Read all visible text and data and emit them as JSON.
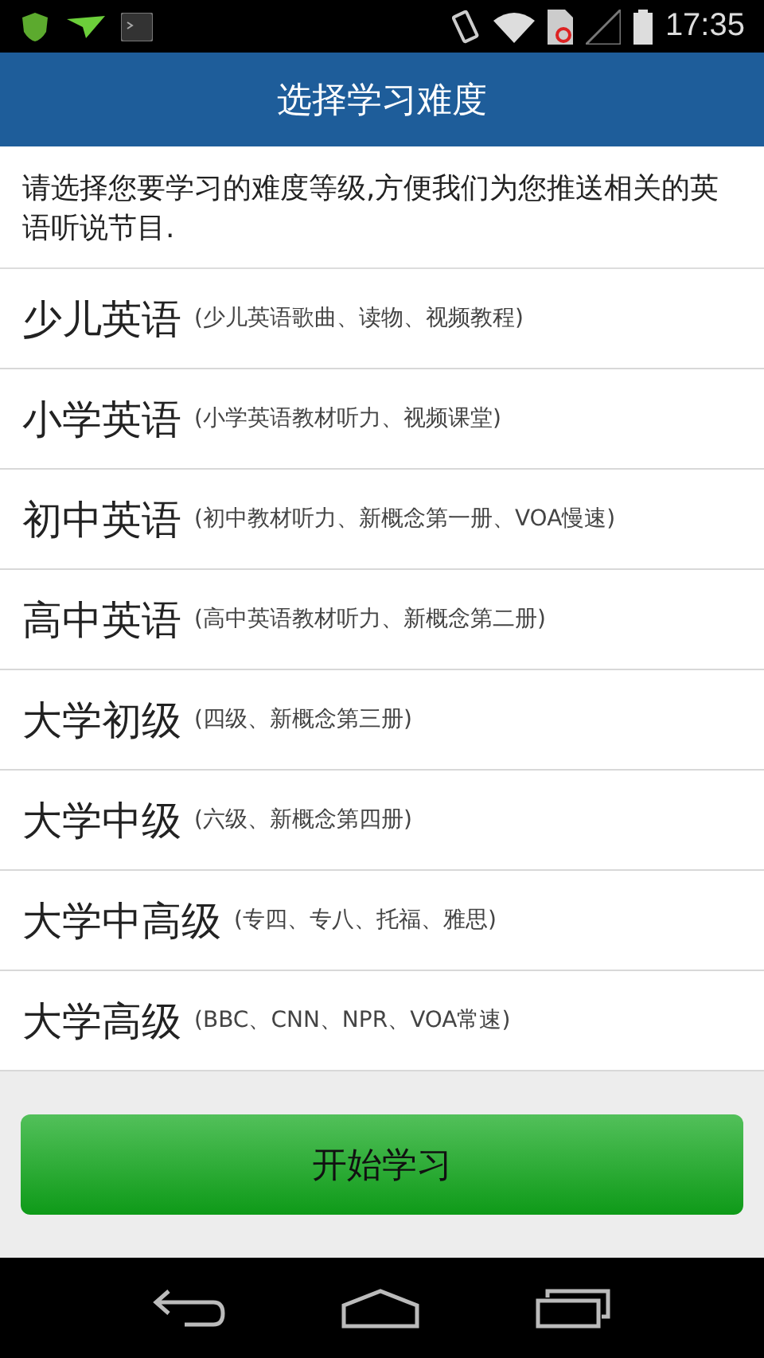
{
  "status_bar": {
    "time": "17:35"
  },
  "title": "选择学习难度",
  "intro": "请选择您要学习的难度等级,方便我们为您推送相关的英语听说节目.",
  "levels": [
    {
      "name": "少儿英语",
      "detail": "(少儿英语歌曲、读物、视频教程)"
    },
    {
      "name": "小学英语",
      "detail": "(小学英语教材听力、视频课堂)"
    },
    {
      "name": "初中英语",
      "detail": "(初中教材听力、新概念第一册、VOA慢速)"
    },
    {
      "name": "高中英语",
      "detail": "(高中英语教材听力、新概念第二册)"
    },
    {
      "name": "大学初级",
      "detail": "(四级、新概念第三册)"
    },
    {
      "name": "大学中级",
      "detail": "(六级、新概念第四册)"
    },
    {
      "name": "大学中高级",
      "detail": "(专四、专八、托福、雅思)"
    },
    {
      "name": "大学高级",
      "detail": "(BBC、CNN、NPR、VOA常速)"
    }
  ],
  "start_button": "开始学习"
}
